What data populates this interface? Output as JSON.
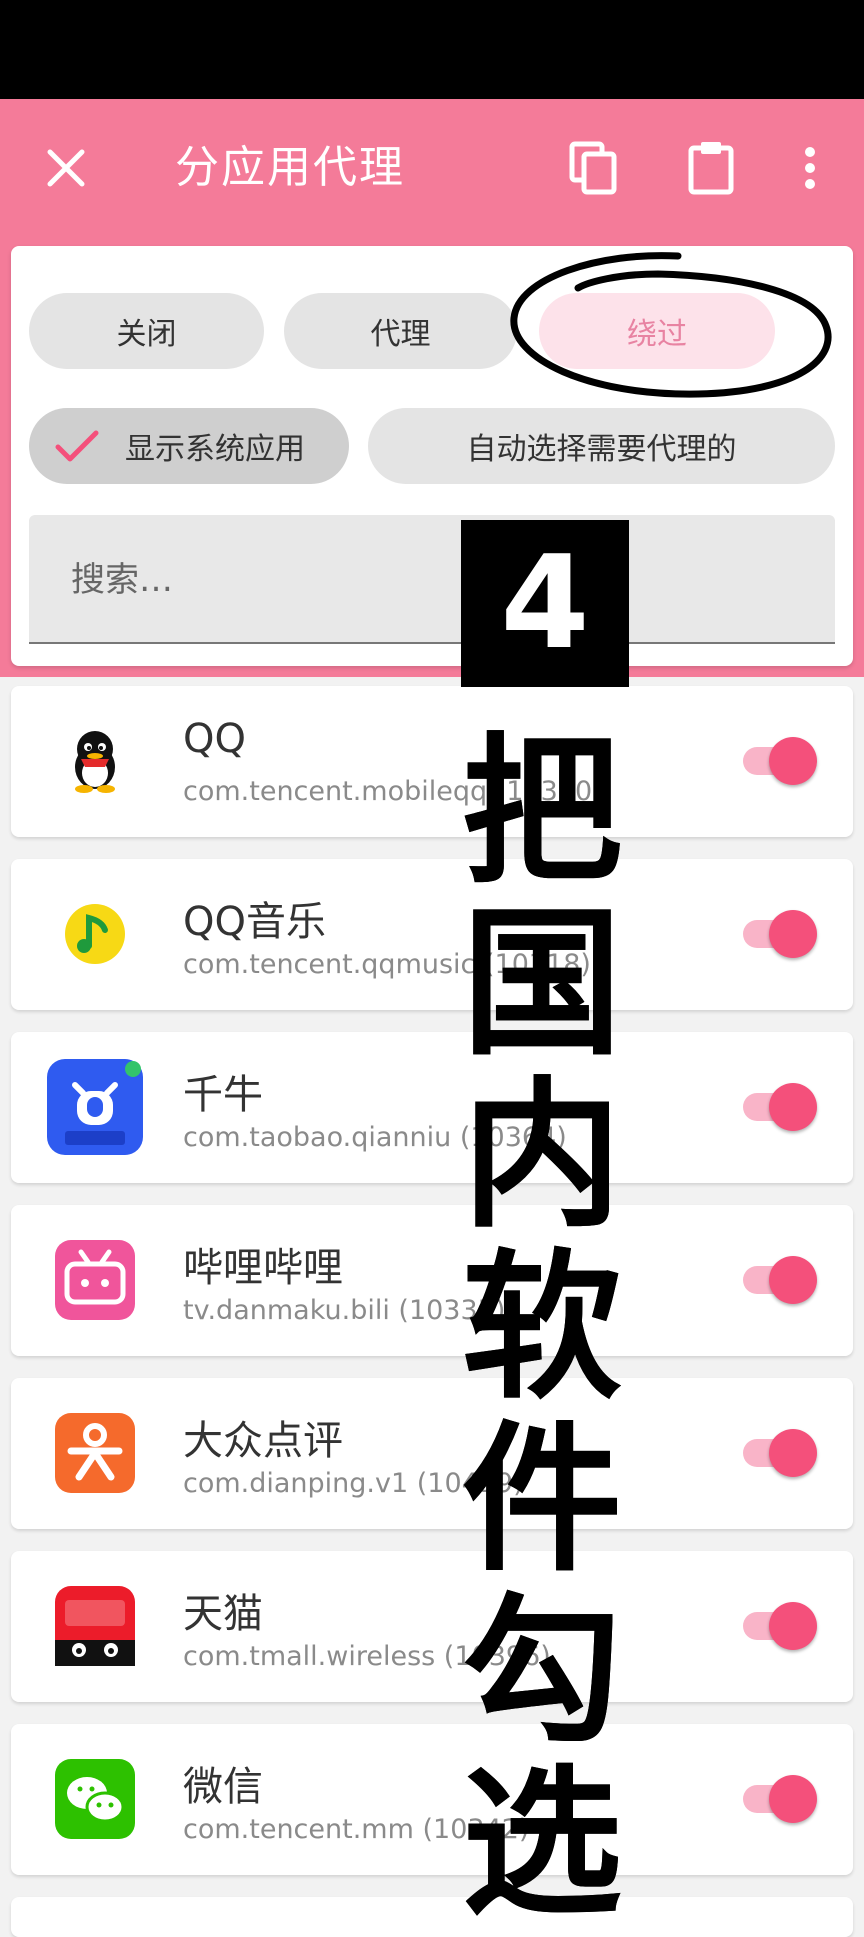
{
  "appbar": {
    "title": "分应用代理",
    "close_icon": "close-icon",
    "copy_icon": "copy-icon",
    "paste_icon": "clipboard-icon",
    "more_icon": "more-vert-icon"
  },
  "mode": {
    "off": "关闭",
    "proxy": "代理",
    "bypass": "绕过",
    "selected": "bypass"
  },
  "filters": {
    "show_system": "显示系统应用",
    "show_system_checked": true,
    "auto_select": "自动选择需要代理的"
  },
  "search": {
    "placeholder": "搜索…",
    "value": ""
  },
  "apps": [
    {
      "name": "QQ",
      "pkg": "com.tencent.mobileqq (10350)",
      "enabled": true
    },
    {
      "name": "QQ音乐",
      "pkg": "com.tencent.qqmusic (10318)",
      "enabled": true
    },
    {
      "name": "千牛",
      "pkg": "com.taobao.qianniu (10364)",
      "enabled": true
    },
    {
      "name": "哔哩哔哩",
      "pkg": "tv.danmaku.bili (10335)",
      "enabled": true
    },
    {
      "name": "大众点评",
      "pkg": "com.dianping.v1 (10419)",
      "enabled": true
    },
    {
      "name": "天猫",
      "pkg": "com.tmall.wireless (10396)",
      "enabled": true
    },
    {
      "name": "微信",
      "pkg": "com.tencent.mm (10342)",
      "enabled": true
    }
  ],
  "overlay": {
    "step": "4",
    "chars": [
      "把",
      "国",
      "内",
      "软",
      "件",
      "勾",
      "选"
    ]
  },
  "colors": {
    "accent": "#f47b99",
    "toggle_on": "#f4507b",
    "toggle_track": "#f9b4c8"
  }
}
